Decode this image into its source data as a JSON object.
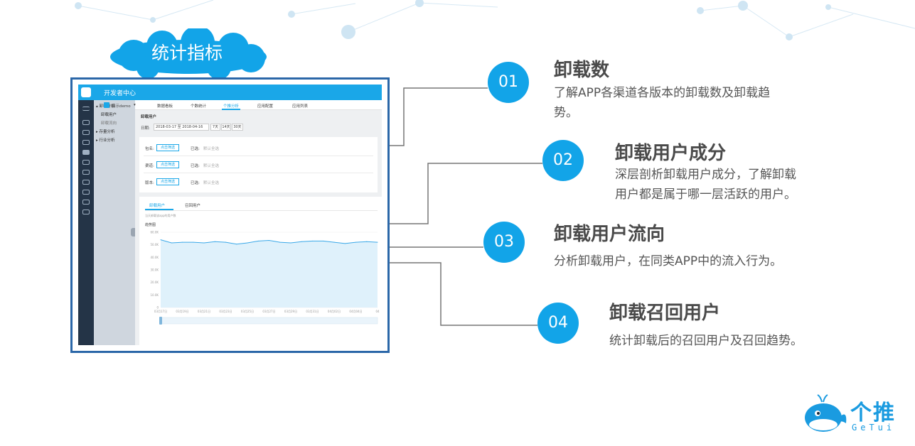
{
  "cloud_label": "统计指标",
  "screenshot": {
    "app_title": "开发者中心",
    "app_select": "演示demo",
    "tabs": [
      "数据看板",
      "个数统计",
      "个推分析",
      "应用配置",
      "应用列表"
    ],
    "side_menu": {
      "group1": "▴ 卸载分析",
      "sub1": "卸载用户",
      "sub2": "卸载流向",
      "group2": "▸ 存量分析",
      "group3": "▸ 行业分析"
    },
    "page_title": "卸载用户",
    "date_label": "日期:",
    "date_range": "2018-03-17 至 2018-04-16",
    "range_buttons": [
      "7天",
      "14天",
      "30天"
    ],
    "filters": [
      {
        "label": "包名:",
        "button": "点击筛选",
        "selected_label": "已选:",
        "selected_value": "默认全选"
      },
      {
        "label": "渠道:",
        "button": "点击筛选",
        "selected_label": "已选:",
        "selected_value": "默认全选"
      },
      {
        "label": "版本:",
        "button": "点击筛选",
        "selected_label": "已选:",
        "selected_value": "默认全选"
      }
    ],
    "chart_tabs": [
      "卸载用户",
      "召回用户"
    ],
    "chart_caption": "当天卸载该app的用户数",
    "chart_heading": "趋势图"
  },
  "chart_data": {
    "type": "area",
    "y_ticks": [
      "60.0K",
      "50.0K",
      "40.0K",
      "30.0K",
      "20.0K",
      "10.0K",
      "0"
    ],
    "x_ticks": [
      "03月17日",
      "03月19日",
      "03月21日",
      "03月23日",
      "03月25日",
      "03月27日",
      "03月29日",
      "03月31日",
      "04月02日",
      "04月04日",
      "04"
    ],
    "ylim": [
      0,
      60000
    ],
    "values": [
      54000,
      51500,
      52000,
      52000,
      51500,
      52500,
      52000,
      50500,
      51500,
      53000,
      53500,
      52000,
      51500,
      52500,
      53000,
      53000,
      52000,
      51000,
      52000,
      52500,
      52000
    ],
    "colors": {
      "line": "#3aa8e8",
      "fill": "#dff1fb"
    }
  },
  "items": [
    {
      "number": "01",
      "title": "卸载数",
      "desc": [
        "了解APP各渠道各版本的卸载数及卸载趋",
        "势。"
      ]
    },
    {
      "number": "02",
      "title": "卸载用户成分",
      "desc": [
        "深层剖析卸载用户成分，了解卸载",
        "用户都是属于哪一层活跃的用户。"
      ]
    },
    {
      "number": "03",
      "title": "卸载用户流向",
      "desc": [
        "分析卸载用户，在同类APP中的流入行为。"
      ]
    },
    {
      "number": "04",
      "title": "卸载召回用户",
      "desc": [
        "统计卸载后的召回用户及召回趋势。"
      ]
    }
  ],
  "brand": {
    "cn": "个推",
    "en": "GeTui"
  },
  "colors": {
    "accent": "#12a4e8",
    "frame": "#2b67a8",
    "title": "#4a4a4a"
  }
}
